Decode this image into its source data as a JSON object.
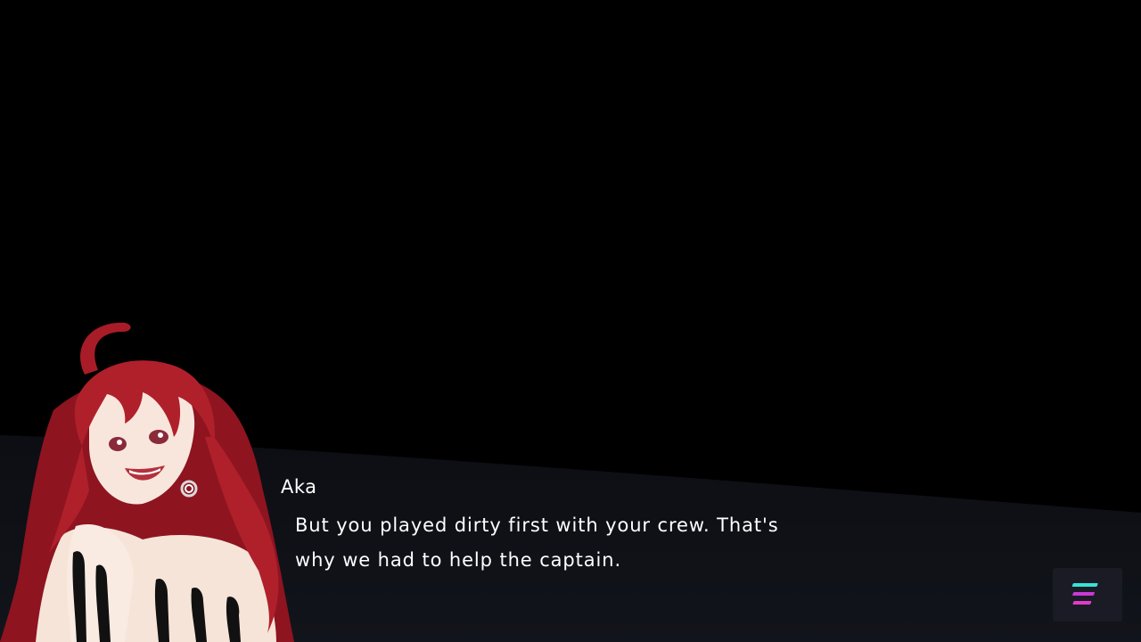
{
  "dialogue": {
    "speaker": "Aka",
    "line": "But you played dirty first with your crew. That's\nwhy we had to help the captain."
  },
  "character": {
    "name": "Aka",
    "hair_color": "#b0202a",
    "skin_color": "#f6e4d8"
  },
  "menu_button": {
    "icon": "menu-icon",
    "colors": [
      "#36e3d6",
      "#c83ad8",
      "#e03cc8"
    ]
  },
  "theme": {
    "background": "#000000",
    "dialogue_panel": "#0c0e13",
    "text": "#ffffff"
  }
}
